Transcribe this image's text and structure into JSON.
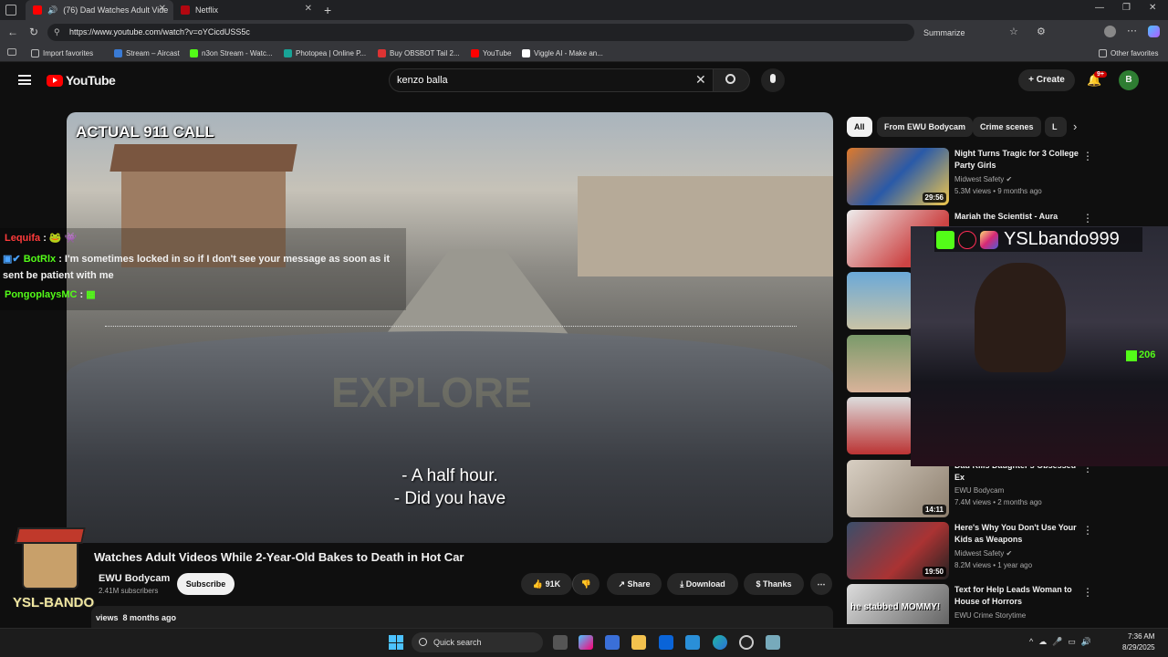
{
  "browser": {
    "tabs": [
      {
        "label": "(76) Dad Watches Adult Vide",
        "active": true
      },
      {
        "label": "Netflix",
        "active": false
      }
    ],
    "url": "https://www.youtube.com/watch?v=oYCicdUSS5c",
    "summarize": "Summarize",
    "bookmarks": [
      "Import favorites",
      "Stream – Aircast",
      "n3on Stream - Watc...",
      "Photopea | Online P...",
      "Buy OBSBOT Tail 2...",
      "YouTube",
      "Viggle AI - Make an..."
    ],
    "other_favorites": "Other favorites"
  },
  "youtube": {
    "logo": "YouTube",
    "search_value": "kenzo balla",
    "create": "Create",
    "notif_count": "9+",
    "avatar_letter": "B"
  },
  "video": {
    "overlay_label": "ACTUAL 911 CALL",
    "caption_line1": "- A half hour.",
    "caption_line2": "- Did you have",
    "title": "Watches Adult Videos While 2-Year-Old Bakes to Death in Hot Car",
    "channel": "EWU Bodycam",
    "subscribers": "2.41M subscribers",
    "subscribe": "Subscribe",
    "likes": "91K",
    "share": "Share",
    "download": "Download",
    "thanks": "Thanks",
    "meta_views": "views",
    "meta_age": "8 months ago"
  },
  "chat": [
    {
      "user": "Lequifa",
      "msg": ":"
    },
    {
      "user": "BotRlx",
      "msg": ": I'm sometimes locked in so if I don't see your message as soon as it sent be patient with me"
    },
    {
      "user": "PongoplaysMC",
      "msg": ":"
    }
  ],
  "stream_overlay": {
    "handle": "YSLbando999",
    "kick_count": "206",
    "logo_text": "YSL-BANDO"
  },
  "chips": [
    "All",
    "From EWU Bodycam",
    "Crime scenes",
    "L"
  ],
  "recommendations": [
    {
      "title": "Night Turns Tragic for 3 College Party Girls",
      "channel": "Midwest Safety",
      "meta": "5.3M views • 9 months ago",
      "duration": "29:56"
    },
    {
      "title": "Mariah the Scientist - Aura",
      "channel": "",
      "meta": "",
      "duration": ""
    },
    {
      "title": "Dad Kills Daughter's Obsessed Ex",
      "channel": "EWU Bodycam",
      "meta": "7.4M views • 2 months ago",
      "duration": "14:11"
    },
    {
      "title": "Here's Why You Don't Use Your Kids as Weapons",
      "channel": "Midwest Safety",
      "meta": "8.2M views • 1 year ago",
      "duration": "19:50"
    },
    {
      "title": "Text for Help Leads Woman to House of Horrors",
      "channel": "EWU Crime Storytime",
      "meta": "",
      "duration": ""
    }
  ],
  "taskbar": {
    "search": "Quick search",
    "time": "7:36 AM",
    "date": "8/29/2025"
  },
  "colors": {
    "yt_red": "#ff0000",
    "accent_green": "#53fc18"
  }
}
